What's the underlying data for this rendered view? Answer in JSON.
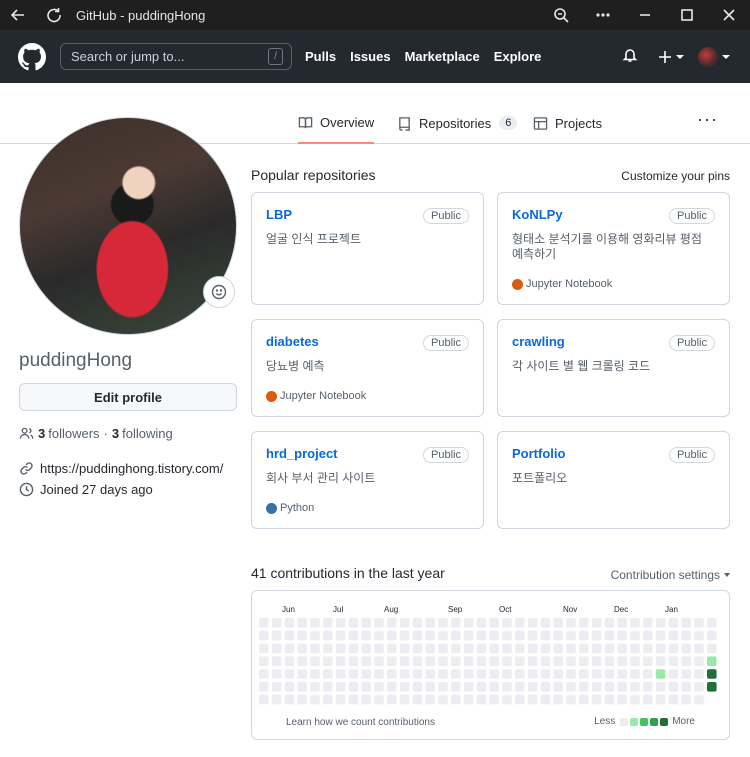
{
  "browser": {
    "title": "GitHub - puddingHong"
  },
  "header": {
    "search_placeholder": "Search or jump to...",
    "slash_key": "/",
    "nav": [
      "Pulls",
      "Issues",
      "Marketplace",
      "Explore"
    ]
  },
  "tabs": {
    "overview": "Overview",
    "repositories": "Repositories",
    "repositories_count": "6",
    "projects": "Projects"
  },
  "profile": {
    "username": "puddingHong",
    "edit_label": "Edit profile",
    "followers_count": "3",
    "followers_label": "followers",
    "following_count": "3",
    "following_label": "following",
    "separator": "·",
    "website": "https://puddinghong.tistory.com/",
    "joined": "Joined 27 days ago"
  },
  "popular": {
    "title": "Popular repositories",
    "customize": "Customize your pins",
    "repos": [
      {
        "name": "LBP",
        "visibility": "Public",
        "desc": "얼굴 인식 프로젝트",
        "lang": "",
        "lang_color": ""
      },
      {
        "name": "KoNLPy",
        "visibility": "Public",
        "desc": "형태소 분석기를 이용해 영화리뷰 평점 예측하기",
        "lang": "Jupyter Notebook",
        "lang_color": "#DA5B0B"
      },
      {
        "name": "diabetes",
        "visibility": "Public",
        "desc": "당뇨병 예측",
        "lang": "Jupyter Notebook",
        "lang_color": "#DA5B0B"
      },
      {
        "name": "crawling",
        "visibility": "Public",
        "desc": "각 사이트 별 웹 크롤링 코드",
        "lang": "",
        "lang_color": ""
      },
      {
        "name": "hrd_project",
        "visibility": "Public",
        "desc": "회사 부서 관리 사이트",
        "lang": "Python",
        "lang_color": "#3572A5"
      },
      {
        "name": "Portfolio",
        "visibility": "Public",
        "desc": "포트폴리오",
        "lang": "",
        "lang_color": ""
      }
    ]
  },
  "contributions": {
    "title": "41 contributions in the last year",
    "settings": "Contribution settings",
    "months": [
      "Jun",
      "Jul",
      "Aug",
      "Sep",
      "Oct",
      "Nov",
      "Dec",
      "Jan"
    ],
    "learn": "Learn how we count contributions",
    "less": "Less",
    "more": "More",
    "colors": [
      "#ebedf0",
      "#9be9a8",
      "#40c463",
      "#30a14e",
      "#216e39"
    ],
    "active_cells": [
      {
        "week": 31,
        "day": 4,
        "level": 1
      },
      {
        "week": 35,
        "day": 3,
        "level": 1
      },
      {
        "week": 35,
        "day": 4,
        "level": 4
      },
      {
        "week": 35,
        "day": 5,
        "level": 4
      }
    ]
  }
}
